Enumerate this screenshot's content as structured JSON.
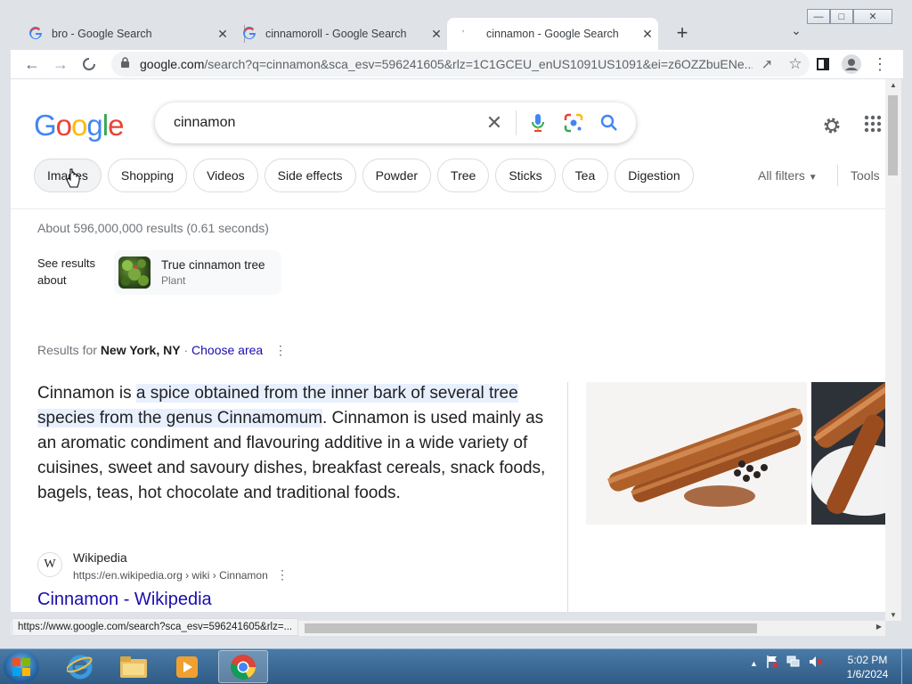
{
  "browser": {
    "tabs": [
      {
        "title": "bro - Google Search",
        "active": false
      },
      {
        "title": "cinnamoroll - Google Search",
        "active": false
      },
      {
        "title": "cinnamon - Google Search",
        "active": true
      }
    ],
    "url_domain": "google.com",
    "url_rest": "/search?q=cinnamon&sca_esv=596241605&rlz=1C1GCEU_enUS1091US1091&ei=z6OZZbuENe...",
    "status_url": "https://www.google.com/search?sca_esv=596241605&rlz=..."
  },
  "google": {
    "logo": "Google",
    "query": "cinnamon",
    "chips": [
      "Images",
      "Shopping",
      "Videos",
      "Side effects",
      "Powder",
      "Tree",
      "Sticks",
      "Tea",
      "Digestion"
    ],
    "all_filters": "All filters",
    "tools": "Tools",
    "stats": "About 596,000,000 results (0.61 seconds)",
    "see_results_about": "See results about",
    "see_title": "True cinnamon tree",
    "see_sub": "Plant",
    "results_for_prefix": "Results for ",
    "results_for_place": "New York, NY",
    "results_for_sep": " · ",
    "choose_area": "Choose area",
    "snippet_pre": "Cinnamon is ",
    "snippet_hl": "a spice obtained from the inner bark of several tree species from the genus Cinnamomum",
    "snippet_post": ". Cinnamon is used mainly as an aromatic condiment and flavouring additive in a wide variety of cuisines, sweet and savoury dishes, breakfast cereals, snack foods, bagels, teas, hot chocolate and traditional foods.",
    "wiki_fav": "W",
    "wiki_name": "Wikipedia",
    "wiki_url": "https://en.wikipedia.org › wiki › Cinnamon",
    "wiki_title": "Cinnamon - Wikipedia"
  },
  "taskbar": {
    "time": "5:02 PM",
    "date": "1/6/2024"
  },
  "icons": [
    "google-g-icon",
    "close-icon",
    "plus-icon",
    "chevron-down-icon",
    "back-icon",
    "forward-icon",
    "stop-icon",
    "lock-icon",
    "share-icon",
    "star-icon",
    "sidepanel-icon",
    "profile-icon",
    "menu-icon",
    "mic-icon",
    "lens-icon",
    "search-icon",
    "gear-icon",
    "apps-icon",
    "cursor-icon"
  ],
  "colors": {
    "link": "#1a0dab",
    "highlight": "#e8f0fe",
    "accent_blue": "#4285f4",
    "red": "#ea4335",
    "yellow": "#fbbc05",
    "green": "#34a853"
  }
}
